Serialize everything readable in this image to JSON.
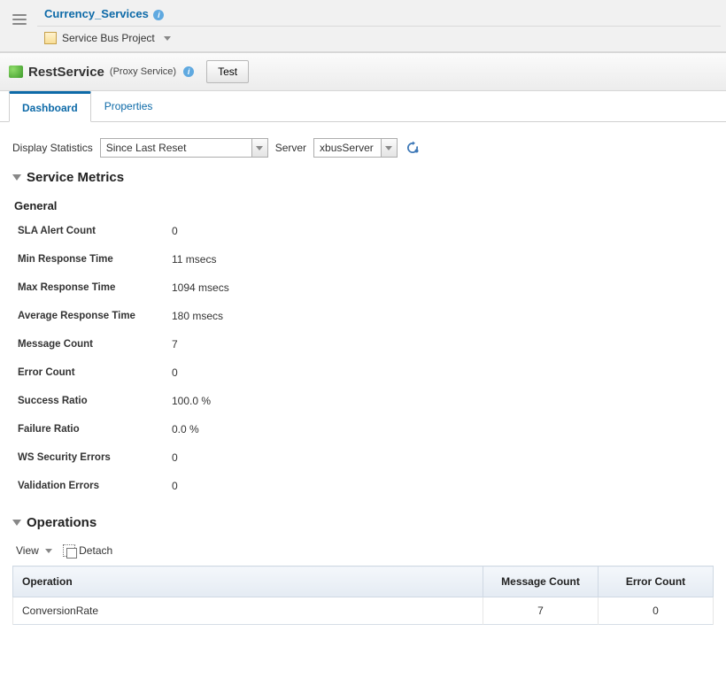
{
  "header": {
    "title": "Currency_Services",
    "projectType": "Service Bus Project"
  },
  "service": {
    "name": "RestService",
    "type": "(Proxy Service)",
    "testLabel": "Test"
  },
  "tabs": [
    {
      "label": "Dashboard",
      "active": true
    },
    {
      "label": "Properties",
      "active": false
    }
  ],
  "filters": {
    "displayStatisticsLabel": "Display Statistics",
    "displayStatisticsValue": "Since Last Reset",
    "serverLabel": "Server",
    "serverValue": "xbusServer"
  },
  "sections": {
    "serviceMetricsTitle": "Service Metrics",
    "generalTitle": "General",
    "operationsTitle": "Operations"
  },
  "metrics": [
    {
      "label": "SLA Alert Count",
      "value": "0"
    },
    {
      "label": "Min Response Time",
      "value": "11 msecs"
    },
    {
      "label": "Max Response Time",
      "value": "1094 msecs"
    },
    {
      "label": "Average Response Time",
      "value": "180 msecs"
    },
    {
      "label": "Message Count",
      "value": "7"
    },
    {
      "label": "Error Count",
      "value": "0"
    },
    {
      "label": "Success Ratio",
      "value": "100.0 %"
    },
    {
      "label": "Failure Ratio",
      "value": "0.0 %"
    },
    {
      "label": "WS Security Errors",
      "value": "0"
    },
    {
      "label": "Validation Errors",
      "value": "0"
    }
  ],
  "opsToolbar": {
    "viewLabel": "View",
    "detachLabel": "Detach"
  },
  "opsTable": {
    "columns": {
      "op": "Operation",
      "msg": "Message Count",
      "err": "Error Count"
    },
    "rows": [
      {
        "op": "ConversionRate",
        "msg": "7",
        "err": "0"
      }
    ]
  }
}
